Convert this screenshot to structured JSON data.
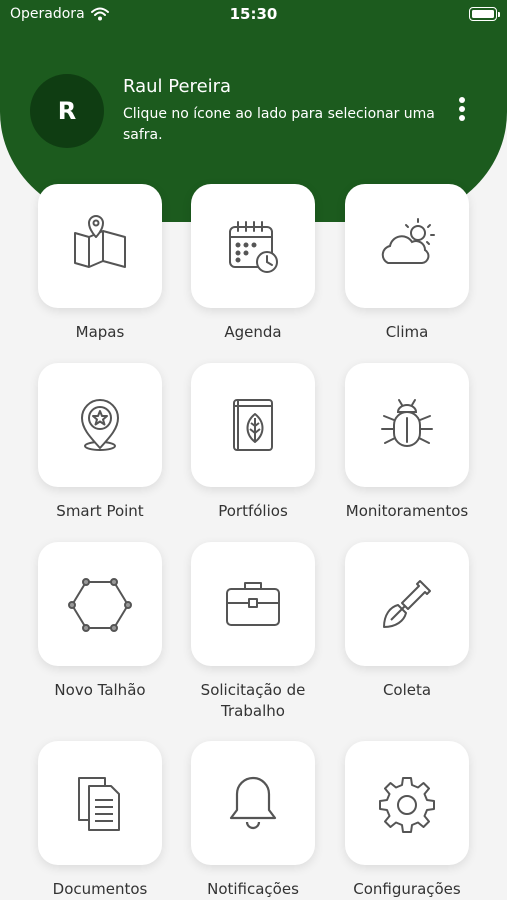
{
  "status_bar": {
    "carrier": "Operadora",
    "time": "15:30"
  },
  "header": {
    "avatar_letter": "R",
    "user_name": "Raul Pereira",
    "hint": "Clique no ícone ao lado para selecionar uma safra."
  },
  "menu": [
    {
      "label": "Mapas",
      "icon": "map-icon"
    },
    {
      "label": "Agenda",
      "icon": "calendar-icon"
    },
    {
      "label": "Clima",
      "icon": "weather-icon"
    },
    {
      "label": "Smart Point",
      "icon": "star-pin-icon"
    },
    {
      "label": "Portfólios",
      "icon": "leaf-book-icon"
    },
    {
      "label": "Monitoramentos",
      "icon": "bug-icon"
    },
    {
      "label": "Novo Talhão",
      "icon": "polygon-icon"
    },
    {
      "label": "Solicitação de Trabalho",
      "icon": "briefcase-icon"
    },
    {
      "label": "Coleta",
      "icon": "shovel-icon"
    },
    {
      "label": "Documentos",
      "icon": "documents-icon"
    },
    {
      "label": "Notificações",
      "icon": "bell-icon"
    },
    {
      "label": "Configurações",
      "icon": "gear-icon"
    }
  ],
  "colors": {
    "header_green": "#1c5b1e",
    "avatar_bg": "#0f3d12",
    "background": "#f4f4f4",
    "icon_stroke": "#555555"
  }
}
